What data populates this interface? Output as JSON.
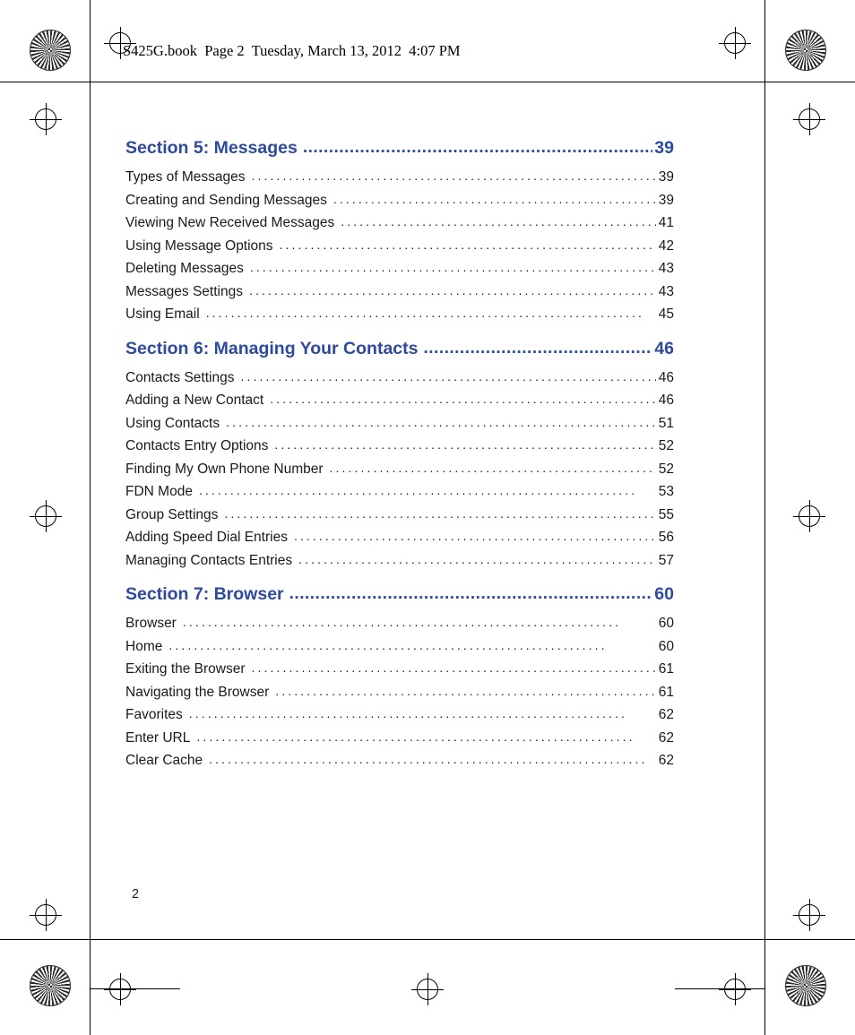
{
  "header": {
    "text": "S425G.book  Page 2  Tuesday, March 13, 2012  4:07 PM"
  },
  "colors": {
    "section_heading": "#2e4a9e",
    "body_text": "#1a1a1a"
  },
  "page_number": "2",
  "toc": {
    "sections": [
      {
        "title": "Section 5:  Messages",
        "page": "39",
        "entries": [
          {
            "label": "Types of Messages",
            "page": "39"
          },
          {
            "label": "Creating and Sending Messages",
            "page": "39"
          },
          {
            "label": "Viewing New Received Messages",
            "page": "41"
          },
          {
            "label": "Using Message Options",
            "page": "42"
          },
          {
            "label": "Deleting Messages",
            "page": "43"
          },
          {
            "label": "Messages Settings",
            "page": "43"
          },
          {
            "label": "Using Email",
            "page": "45"
          }
        ]
      },
      {
        "title": "Section 6:  Managing Your Contacts",
        "page": "46",
        "entries": [
          {
            "label": "Contacts Settings",
            "page": "46"
          },
          {
            "label": "Adding a New Contact",
            "page": "46"
          },
          {
            "label": "Using Contacts",
            "page": "51"
          },
          {
            "label": "Contacts Entry Options",
            "page": "52"
          },
          {
            "label": "Finding My Own Phone Number",
            "page": "52"
          },
          {
            "label": "FDN Mode",
            "page": "53"
          },
          {
            "label": "Group Settings",
            "page": "55"
          },
          {
            "label": "Adding Speed Dial Entries",
            "page": "56"
          },
          {
            "label": "Managing Contacts Entries",
            "page": "57"
          }
        ]
      },
      {
        "title": "Section 7:  Browser",
        "page": "60",
        "entries": [
          {
            "label": "Browser",
            "page": "60"
          },
          {
            "label": "Home",
            "page": "60"
          },
          {
            "label": "Exiting the Browser",
            "page": "61"
          },
          {
            "label": "Navigating the Browser",
            "page": "61"
          },
          {
            "label": "Favorites",
            "page": "62"
          },
          {
            "label": "Enter URL",
            "page": "62"
          },
          {
            "label": "Clear Cache",
            "page": "62"
          }
        ]
      }
    ]
  }
}
